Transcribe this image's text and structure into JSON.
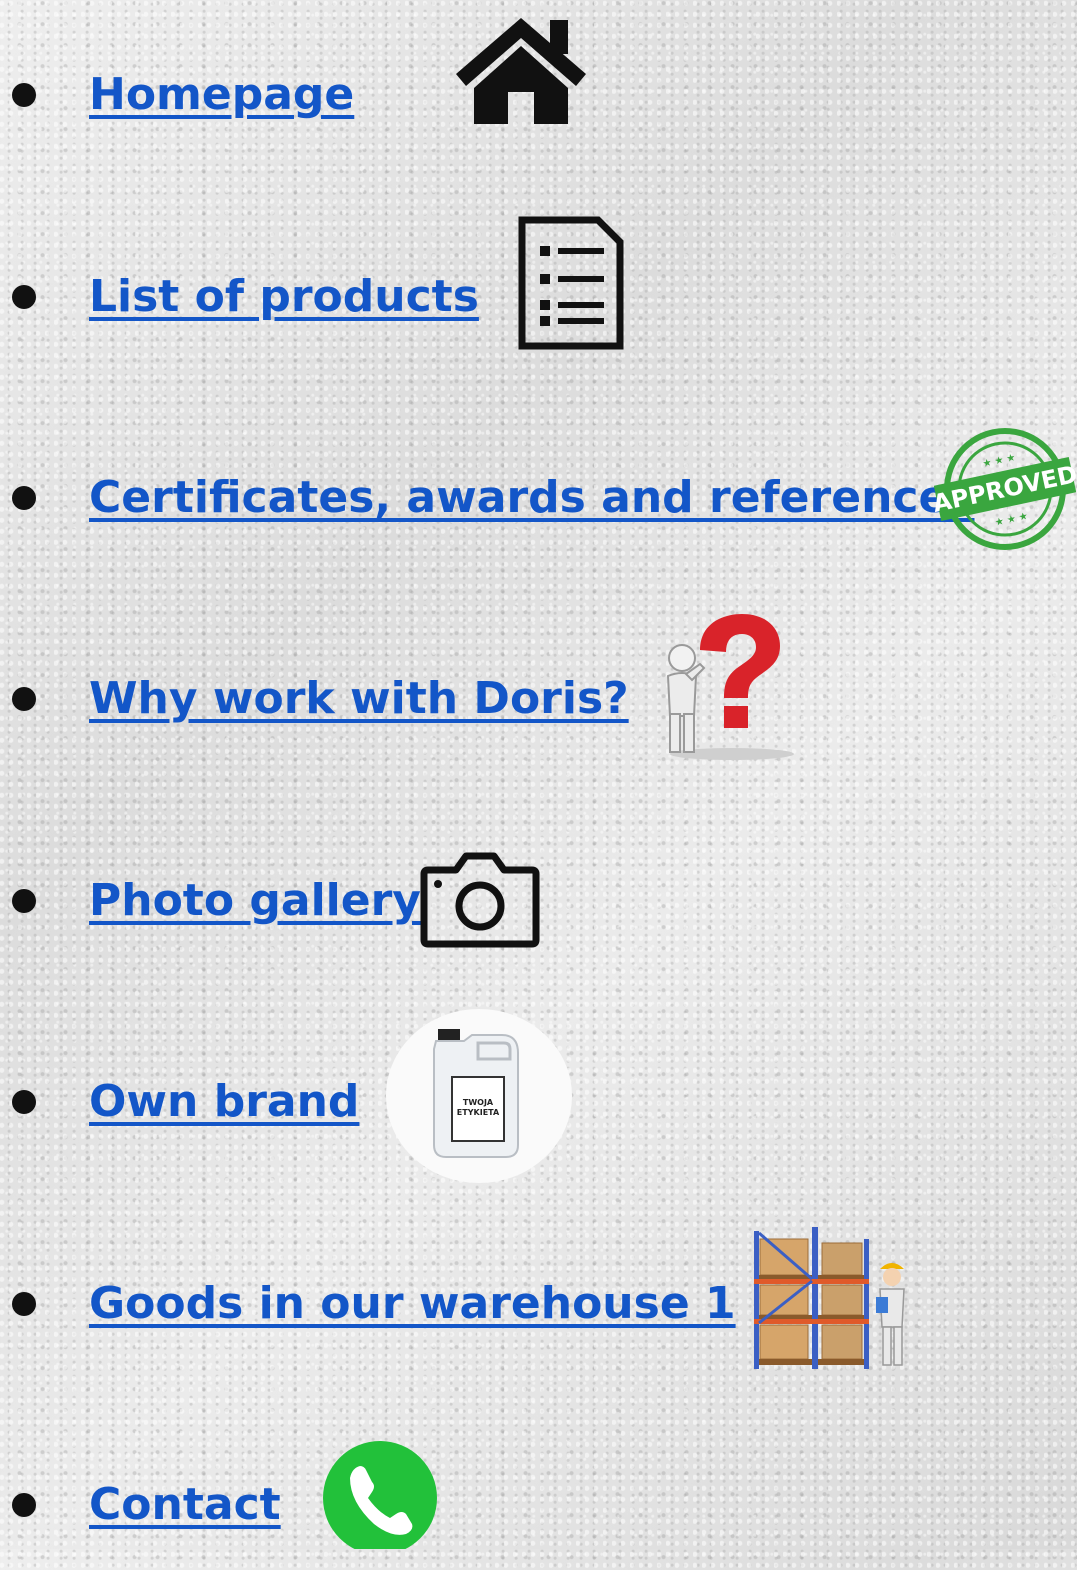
{
  "menu": {
    "items": [
      {
        "label": "Homepage",
        "icon": "home-icon"
      },
      {
        "label": "List of products",
        "icon": "document-list-icon"
      },
      {
        "label": "Certificates, awards and references",
        "icon": "approved-stamp-icon"
      },
      {
        "label": "Why work with Doris?",
        "icon": "question-mark-figure-icon"
      },
      {
        "label": "Photo gallery",
        "icon": "camera-icon"
      },
      {
        "label": "Own brand",
        "icon": "canister-icon"
      },
      {
        "label": "Goods in our warehouse 1",
        "icon": "warehouse-icon"
      },
      {
        "label": "Contact",
        "icon": "phone-icon"
      }
    ]
  },
  "stamp": {
    "text": "APPROVED"
  },
  "canister": {
    "label_line1": "TWOJA",
    "label_line2": "ETYKIETA"
  },
  "colors": {
    "link": "#1356c8",
    "bullet": "#111111",
    "stamp_green": "#3aa63f",
    "question_red": "#d9232a",
    "phone_green": "#22c13a"
  }
}
